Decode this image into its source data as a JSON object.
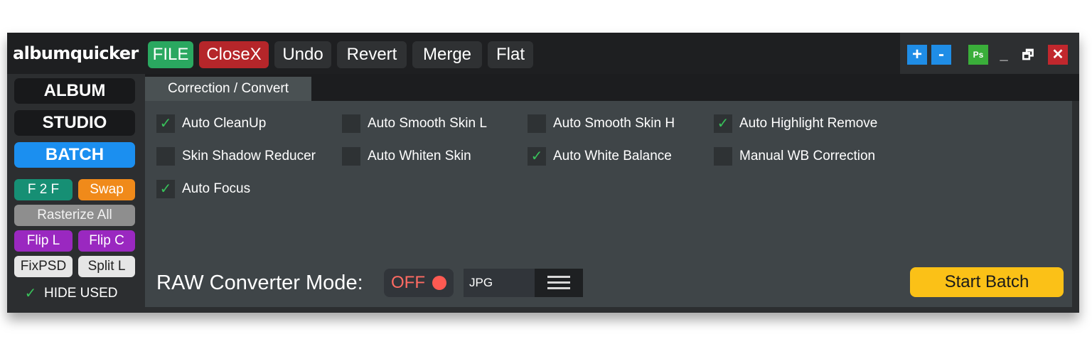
{
  "app": {
    "logo": "albumquicker"
  },
  "toolbar": {
    "buttons": [
      {
        "label": "FILE",
        "color": "#2aa860"
      },
      {
        "label": "CloseX",
        "color": "#b5262a"
      },
      {
        "label": "Undo"
      },
      {
        "label": "Revert"
      },
      {
        "label": "Merge"
      },
      {
        "label": "Flat"
      }
    ]
  },
  "window_controls": {
    "zoom_in": "+",
    "zoom_out": "-",
    "photoshop": "Ps",
    "minimize": "_",
    "restore": "🗗",
    "close": "✕"
  },
  "sidebar": {
    "modes": [
      "ALBUM",
      "STUDIO",
      "BATCH"
    ],
    "active_mode": "BATCH",
    "tools": {
      "f2f": "F 2 F",
      "swap": "Swap",
      "rasterize_all": "Rasterize All",
      "flip_l": "Flip L",
      "flip_c": "Flip C",
      "fix_psd": "FixPSD",
      "split_l": "Split L"
    },
    "hide_used": {
      "label": "HIDE USED",
      "checked": true,
      "mark": "✓"
    }
  },
  "tabs": {
    "active": "Correction / Convert"
  },
  "options": [
    {
      "label": "Auto CleanUp",
      "checked": true,
      "mark": "✓"
    },
    {
      "label": "Auto Smooth Skin L",
      "checked": false,
      "mark": ""
    },
    {
      "label": "Auto Smooth Skin H",
      "checked": false,
      "mark": ""
    },
    {
      "label": "Auto Highlight Remove",
      "checked": true,
      "mark": "✓"
    },
    {
      "label": "Skin Shadow Reducer",
      "checked": false,
      "mark": ""
    },
    {
      "label": "Auto Whiten Skin",
      "checked": false,
      "mark": ""
    },
    {
      "label": "Auto White Balance",
      "checked": true,
      "mark": "✓"
    },
    {
      "label": "Manual WB Correction",
      "checked": false,
      "mark": ""
    },
    {
      "label": "Auto Focus",
      "checked": true,
      "mark": "✓"
    }
  ],
  "raw_converter": {
    "label": "RAW Converter Mode:",
    "state": "OFF",
    "format": "JPG"
  },
  "actions": {
    "start_batch": "Start Batch"
  },
  "colors": {
    "accent_blue": "#1b8ff0",
    "start_batch": "#fbc117",
    "check": "#38c15a"
  }
}
